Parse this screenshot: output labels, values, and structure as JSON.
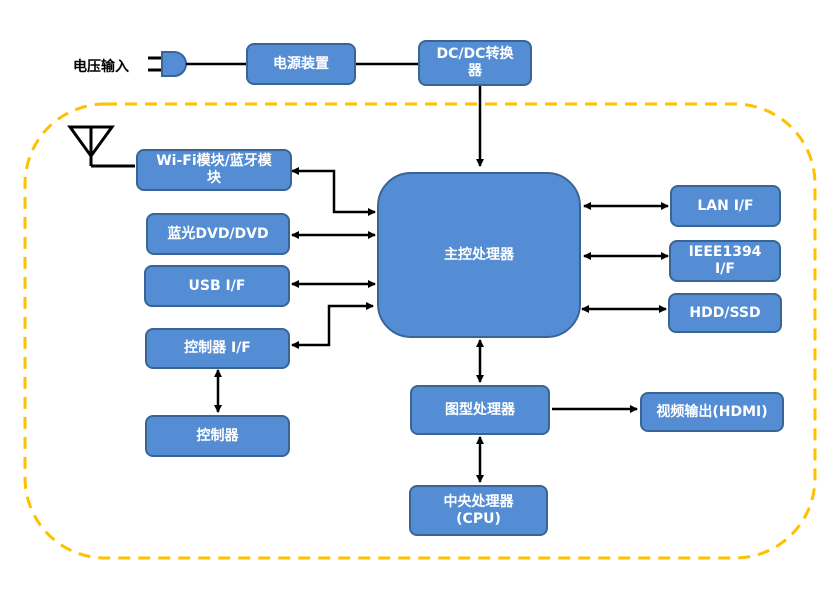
{
  "diagram": {
    "colors": {
      "box_fill": "#548dd4",
      "box_border": "#3a6496",
      "box_text": "#ffffff",
      "connector": "#000000",
      "boundary_dashed": "#ffc000"
    },
    "voltage_input_label": "电压输入",
    "icons": {
      "plug": "power-plug-icon",
      "antenna": "antenna-icon"
    },
    "nodes": {
      "power_supply": "电源装置",
      "dcdc_converter": "DC/DC转换\n器",
      "wifi_bt": "Wi-Fi模块/蓝牙模\n块",
      "bluray_dvd": "蓝光DVD/DVD",
      "usb_if": "USB I/F",
      "controller_if": "控制器  I/F",
      "controller": "控制器",
      "main_processor": "主控处理器",
      "lan_if": "LAN I/F",
      "ieee1394_if": "IEEE1394\nI/F",
      "hdd_ssd": "HDD/SSD",
      "graphics_processor": "图型处理器",
      "video_output": "视频输出(HDMI)",
      "cpu": "中央处理器\n(CPU)"
    },
    "edges": [
      {
        "from": "voltage_input",
        "to": "power_supply",
        "type": "line"
      },
      {
        "from": "power_supply",
        "to": "dcdc_converter",
        "type": "line"
      },
      {
        "from": "dcdc_converter",
        "to": "main_processor",
        "type": "arrow"
      },
      {
        "from": "antenna",
        "to": "wifi_bt",
        "type": "line"
      },
      {
        "from": "wifi_bt",
        "to": "main_processor",
        "type": "bidirectional"
      },
      {
        "from": "bluray_dvd",
        "to": "main_processor",
        "type": "bidirectional"
      },
      {
        "from": "usb_if",
        "to": "main_processor",
        "type": "bidirectional"
      },
      {
        "from": "controller_if",
        "to": "main_processor",
        "type": "bidirectional"
      },
      {
        "from": "controller_if",
        "to": "controller",
        "type": "bidirectional"
      },
      {
        "from": "main_processor",
        "to": "lan_if",
        "type": "bidirectional"
      },
      {
        "from": "main_processor",
        "to": "ieee1394_if",
        "type": "bidirectional"
      },
      {
        "from": "main_processor",
        "to": "hdd_ssd",
        "type": "bidirectional"
      },
      {
        "from": "main_processor",
        "to": "graphics_processor",
        "type": "bidirectional"
      },
      {
        "from": "graphics_processor",
        "to": "video_output",
        "type": "arrow"
      },
      {
        "from": "graphics_processor",
        "to": "cpu",
        "type": "bidirectional"
      }
    ]
  }
}
